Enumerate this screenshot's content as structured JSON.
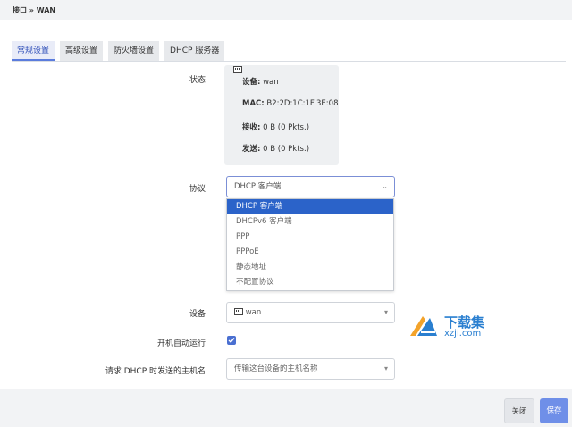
{
  "breadcrumb": "接口 » WAN",
  "tabs": [
    {
      "label": "常规设置"
    },
    {
      "label": "高级设置"
    },
    {
      "label": "防火墙设置"
    },
    {
      "label": "DHCP 服务器"
    }
  ],
  "status": {
    "label": "状态",
    "device_key": "设备:",
    "device_val": "wan",
    "mac_key": "MAC:",
    "mac_val": "B2:2D:1C:1F:3E:08",
    "rx_key": "接收:",
    "rx_val": "0 B (0 Pkts.)",
    "tx_key": "发送:",
    "tx_val": "0 B (0 Pkts.)"
  },
  "protocol": {
    "label": "协议",
    "value": "DHCP 客户端",
    "options": [
      "DHCP 客户端",
      "DHCPv6 客户端",
      "PPP",
      "PPPoE",
      "静态地址",
      "不配置协议"
    ]
  },
  "device": {
    "label": "设备",
    "value": "wan"
  },
  "autostart": {
    "label": "开机自动运行",
    "checked": true
  },
  "hostname": {
    "label": "请求 DHCP 时发送的主机名",
    "placeholder": "传输这台设备的主机名称"
  },
  "buttons": {
    "close": "关闭",
    "save": "保存"
  },
  "watermark": {
    "big": "下载集",
    "small": "xzji.com"
  }
}
